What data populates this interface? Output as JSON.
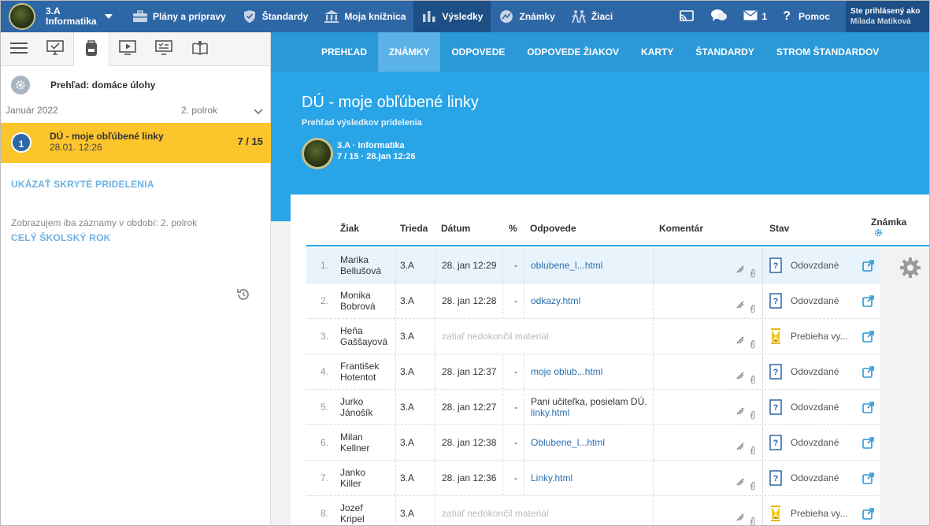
{
  "topbar": {
    "class_name": "3.A",
    "subject": "Informatika",
    "nav": [
      {
        "label": "Plány a prípravy",
        "icon": "briefcase-icon"
      },
      {
        "label": "Štandardy",
        "icon": "shield-icon"
      },
      {
        "label": "Moja knižnica",
        "icon": "library-icon"
      },
      {
        "label": "Výsledky",
        "icon": "bar-chart-icon"
      },
      {
        "label": "Známky",
        "icon": "grades-icon"
      },
      {
        "label": "Žiaci",
        "icon": "students-icon"
      }
    ],
    "message_count": "1",
    "help_label": "Pomoc",
    "logged_in_label": "Ste prihlásený ako",
    "user_name": "Milada Matiková"
  },
  "left": {
    "overview_title": "Prehľad: domáce úlohy",
    "month": "Január 2022",
    "semester": "2. polrok",
    "active_item": {
      "number": "1",
      "title": "DÚ - moje obľúbené linky",
      "date": "28.01. 12:26",
      "score": "7 / 15"
    },
    "show_hidden": "UKÁZAŤ SKRYTÉ PRIDELENIA",
    "filter_text": "Zobrazujem iba záznamy v období: 2. polrok",
    "whole_year": "CELÝ ŠKOLSKÝ ROK"
  },
  "subnav": [
    "PREHĽAD",
    "ZNÁMKY",
    "ODPOVEDE",
    "ODPOVEDE ŽIAKOV",
    "KARTY",
    "ŠTANDARDY",
    "STROM ŠTANDARDOV"
  ],
  "hero": {
    "title": "DÚ - moje obľúbené linky",
    "subtitle": "Prehľad výsledkov pridelenia",
    "class_line": "3.A · Informatika",
    "meta_line": "7 / 15 · 28.jan 12:26"
  },
  "table": {
    "headers": {
      "student": "Žiak",
      "class": "Trieda",
      "date": "Dátum",
      "percent": "%",
      "answers": "Odpovede",
      "comment": "Komentár",
      "status": "Stav",
      "grade": "Známka"
    },
    "rows": [
      {
        "idx": "1.",
        "first": "Marika",
        "last": "Bellušová",
        "cls": "3.A",
        "date": "28. jan 12:29",
        "pct": "-",
        "text": "",
        "answer": "oblubene_l...html",
        "status": "Odovzdané",
        "state": "done"
      },
      {
        "idx": "2.",
        "first": "Monika",
        "last": "Bobrová",
        "cls": "3.A",
        "date": "28. jan 12:28",
        "pct": "-",
        "text": "",
        "answer": "odkazy.html",
        "status": "Odovzdané",
        "state": "done"
      },
      {
        "idx": "3.",
        "first": "Heňa",
        "last": "Gaššayová",
        "cls": "3.A",
        "date": "",
        "pct": "",
        "text": "",
        "answer": "",
        "pending": "zatiaľ nedokončil materiál",
        "status": "Prebieha vy...",
        "state": "pending"
      },
      {
        "idx": "4.",
        "first": "František",
        "last": "Hotentot",
        "cls": "3.A",
        "date": "28. jan 12:37",
        "pct": "-",
        "text": "",
        "answer": "moje oblub...html",
        "status": "Odovzdané",
        "state": "done"
      },
      {
        "idx": "5.",
        "first": "Jurko",
        "last": "Jánošík",
        "cls": "3.A",
        "date": "28. jan 12:27",
        "pct": "-",
        "text": "Pani učiteľka, posielam DÚ.",
        "answer": "linky.html",
        "status": "Odovzdané",
        "state": "done"
      },
      {
        "idx": "6.",
        "first": "Milan",
        "last": "Kellner",
        "cls": "3.A",
        "date": "28. jan 12:38",
        "pct": "-",
        "text": "",
        "answer": "Oblubene_l...html",
        "status": "Odovzdané",
        "state": "done"
      },
      {
        "idx": "7.",
        "first": "Janko",
        "last": "Killer",
        "cls": "3.A",
        "date": "28. jan 12:36",
        "pct": "-",
        "text": "",
        "answer": "Linky.html",
        "status": "Odovzdané",
        "state": "done"
      },
      {
        "idx": "8.",
        "first": "Jozef",
        "last": "Kripel",
        "cls": "3.A",
        "date": "",
        "pct": "",
        "text": "",
        "answer": "",
        "pending": "zatiaľ nedokončil materiál",
        "status": "Prebieha vy...",
        "state": "pending"
      }
    ]
  },
  "colors": {
    "topbar": "#2e67a6",
    "subnav": "#2b98d8",
    "hero": "#29a4e7",
    "active_item": "#fdc52c",
    "link": "#6cb2e0"
  }
}
